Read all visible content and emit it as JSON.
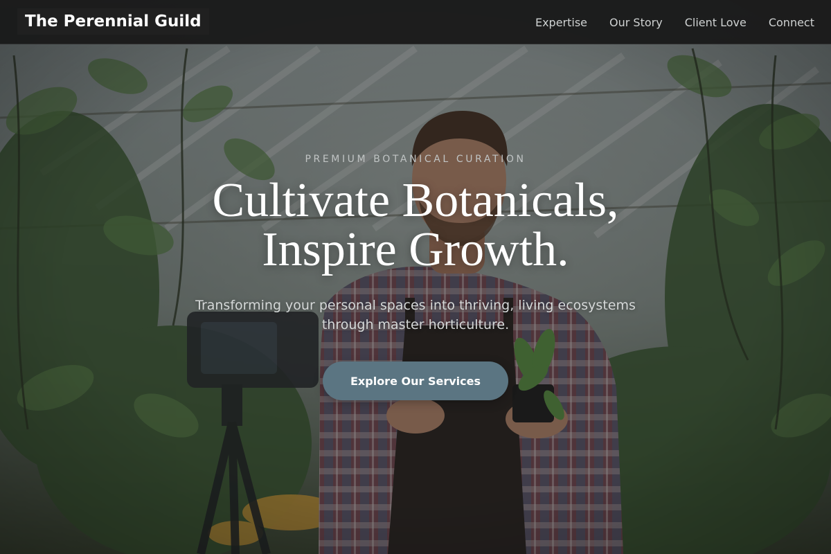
{
  "header": {
    "brand": "The Perennial Guild",
    "nav": [
      {
        "label": "Expertise"
      },
      {
        "label": "Our Story"
      },
      {
        "label": "Client Love"
      },
      {
        "label": "Connect"
      }
    ]
  },
  "hero": {
    "eyebrow": "PREMIUM BOTANICAL CURATION",
    "headline_line1": "Cultivate Botanicals,",
    "headline_line2": "Inspire Growth.",
    "subtitle": "Transforming your personal spaces into thriving, living ecosystems through master horticulture.",
    "cta_label": "Explore Our Services",
    "accent_color": "#5b7582",
    "nav_background": "#1a1a1a"
  }
}
